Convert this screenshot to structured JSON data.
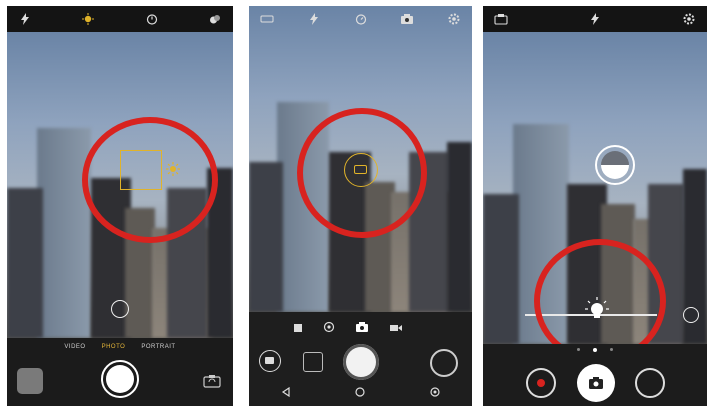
{
  "panel1": {
    "top_icons": [
      "flash-auto-icon",
      "hdr-icon",
      "timer-icon",
      "filter-icon"
    ],
    "modes": [
      "VIDEO",
      "PHOTO",
      "PORTRAIT"
    ],
    "active_mode": "PHOTO",
    "focus_color": "#e0b32a"
  },
  "panel2": {
    "top_icons": [
      "hdr-icon",
      "flash-icon",
      "timer-icon",
      "camera-switch-icon",
      "settings-icon"
    ],
    "mode_icons": [
      "panorama-icon",
      "lens-blur-icon",
      "photo-icon",
      "video-icon"
    ],
    "nav_icons": [
      "back-icon",
      "home-icon",
      "recents-icon"
    ]
  },
  "panel3": {
    "top_icons": [
      "camera-switch-icon",
      "flash-icon",
      "settings-icon"
    ],
    "exposure_level": 0.55
  },
  "colors": {
    "highlight_ring": "#d8231f",
    "accent": "#e0b32a",
    "dark": "#151515"
  }
}
